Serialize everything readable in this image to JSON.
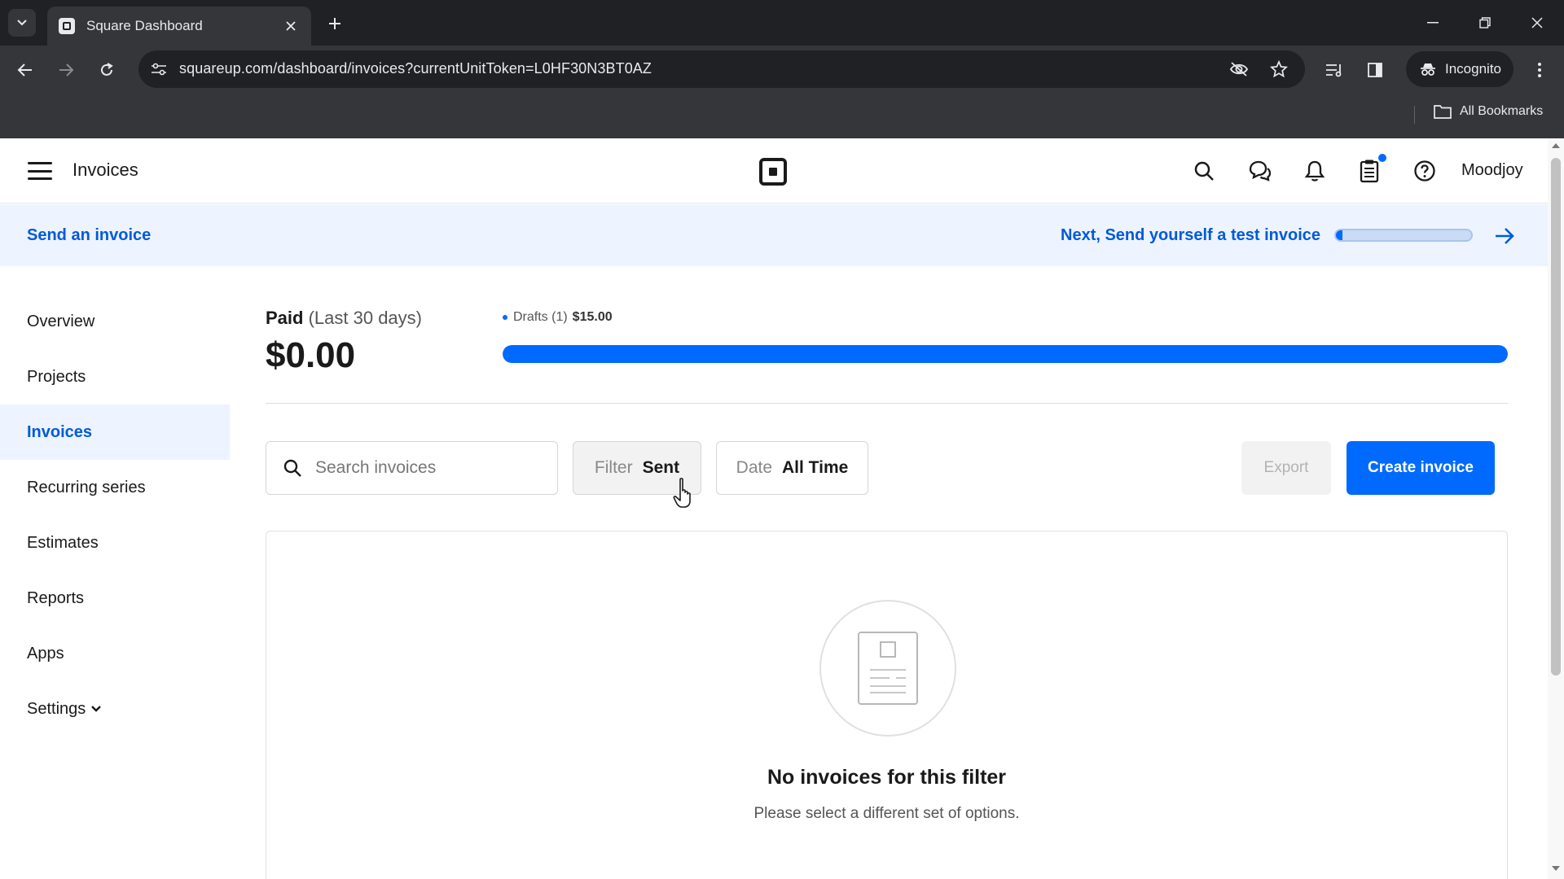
{
  "browser": {
    "tab_title": "Square Dashboard",
    "url": "squareup.com/dashboard/invoices?currentUnitToken=L0HF30N3BT0AZ",
    "incognito_label": "Incognito",
    "bookmarks_label": "All Bookmarks"
  },
  "header": {
    "page_title": "Invoices",
    "user_name": "Moodjoy",
    "icons": [
      "menu-icon",
      "square-logo",
      "search-icon",
      "messages-icon",
      "bell-icon",
      "clipboard-icon",
      "help-icon"
    ]
  },
  "banner": {
    "left_link": "Send an invoice",
    "right_link": "Next, Send yourself a test invoice",
    "progress_fraction": 0.05
  },
  "sidebar": {
    "items": [
      {
        "label": "Overview"
      },
      {
        "label": "Projects"
      },
      {
        "label": "Invoices",
        "active": true
      },
      {
        "label": "Recurring series"
      },
      {
        "label": "Estimates"
      },
      {
        "label": "Reports"
      },
      {
        "label": "Apps"
      },
      {
        "label": "Settings"
      }
    ]
  },
  "summary": {
    "paid_label": "Paid",
    "paid_period": "(Last 30 days)",
    "paid_amount": "$0.00",
    "drafts_label": "Drafts (1)",
    "drafts_amount": "$15.00",
    "drafts_bar_fraction": 1.0
  },
  "controls": {
    "search_placeholder": "Search invoices",
    "filter_key": "Filter",
    "filter_value": "Sent",
    "date_key": "Date",
    "date_value": "All Time",
    "export_label": "Export",
    "create_label": "Create invoice"
  },
  "empty_state": {
    "title": "No invoices for this filter",
    "subtitle": "Please select a different set of options."
  },
  "colors": {
    "accent": "#006aff",
    "link": "#005ad9",
    "banner_bg": "#edf4ff",
    "chrome_dark": "#202124",
    "chrome_mid": "#35363a"
  }
}
